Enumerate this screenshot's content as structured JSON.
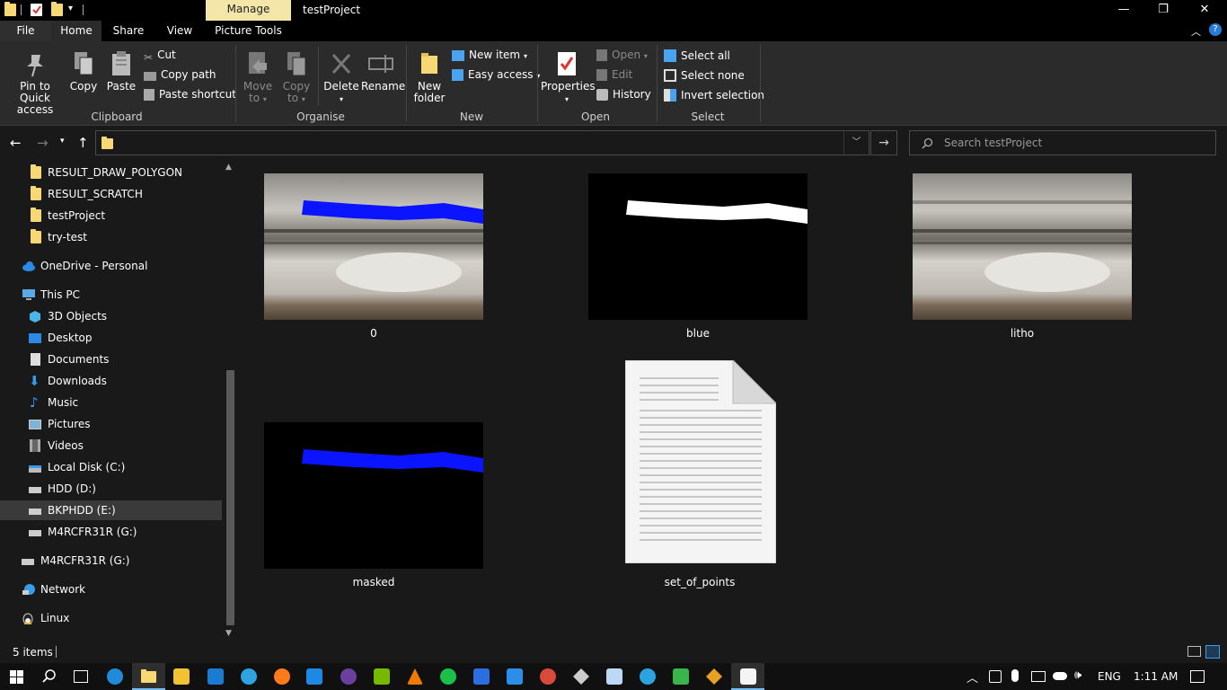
{
  "titlebar": {
    "context_tab": "Manage",
    "window_title": "testProject",
    "minimize": "—",
    "maximize": "❐",
    "close": "✕"
  },
  "ribbon_tabs": {
    "file": "File",
    "home": "Home",
    "share": "Share",
    "view": "View",
    "picture_tools": "Picture Tools"
  },
  "ribbon": {
    "clipboard": {
      "label": "Clipboard",
      "pin": "Pin to Quick access",
      "pin_line1": "Pin to Quick",
      "pin_line2": "access",
      "copy": "Copy",
      "paste": "Paste",
      "cut": "Cut",
      "copy_path": "Copy path",
      "paste_shortcut": "Paste shortcut"
    },
    "organise": {
      "label": "Organise",
      "move_to_1": "Move",
      "move_to_2": "to",
      "copy_to_1": "Copy",
      "copy_to_2": "to",
      "delete": "Delete",
      "rename": "Rename"
    },
    "new": {
      "label": "New",
      "new_folder_1": "New",
      "new_folder_2": "folder",
      "new_item": "New item",
      "easy_access": "Easy access"
    },
    "open": {
      "label": "Open",
      "properties": "Properties",
      "open": "Open",
      "edit": "Edit",
      "history": "History"
    },
    "select": {
      "label": "Select",
      "select_all": "Select all",
      "select_none": "Select none",
      "invert": "Invert selection"
    }
  },
  "search": {
    "placeholder": "Search testProject"
  },
  "nav_pane": {
    "items": [
      {
        "label": "RESULT_DRAW_POLYGON",
        "icon": "folder-icon"
      },
      {
        "label": "RESULT_SCRATCH",
        "icon": "folder-icon"
      },
      {
        "label": "testProject",
        "icon": "folder-icon"
      },
      {
        "label": "try-test",
        "icon": "folder-icon"
      },
      {
        "label": "OneDrive - Personal",
        "icon": "cloud-icon"
      },
      {
        "label": "This PC",
        "icon": "computer-icon"
      },
      {
        "label": "3D Objects",
        "icon": "cube-icon"
      },
      {
        "label": "Desktop",
        "icon": "desktop-icon"
      },
      {
        "label": "Documents",
        "icon": "document-icon"
      },
      {
        "label": "Downloads",
        "icon": "download-icon"
      },
      {
        "label": "Music",
        "icon": "music-icon"
      },
      {
        "label": "Pictures",
        "icon": "pictures-icon"
      },
      {
        "label": "Videos",
        "icon": "video-icon"
      },
      {
        "label": "Local Disk (C:)",
        "icon": "drive-icon"
      },
      {
        "label": "HDD (D:)",
        "icon": "drive-icon"
      },
      {
        "label": "BKPHDD (E:)",
        "icon": "drive-icon"
      },
      {
        "label": "M4RCFR31R (G:)",
        "icon": "drive-icon"
      },
      {
        "label": "M4RCFR31R (G:)",
        "icon": "drive-icon"
      },
      {
        "label": "Network",
        "icon": "network-icon"
      },
      {
        "label": "Linux",
        "icon": "linux-icon"
      }
    ]
  },
  "files": [
    {
      "name": "0",
      "type": "image-rock-blue"
    },
    {
      "name": "blue",
      "type": "image-mask-white"
    },
    {
      "name": "litho",
      "type": "image-rock"
    },
    {
      "name": "masked",
      "type": "image-mask-blue"
    },
    {
      "name": "set_of_points",
      "type": "text-file"
    }
  ],
  "status": {
    "items": "5 items"
  },
  "taskbar": {
    "language": "ENG",
    "time": "1:11 AM"
  }
}
